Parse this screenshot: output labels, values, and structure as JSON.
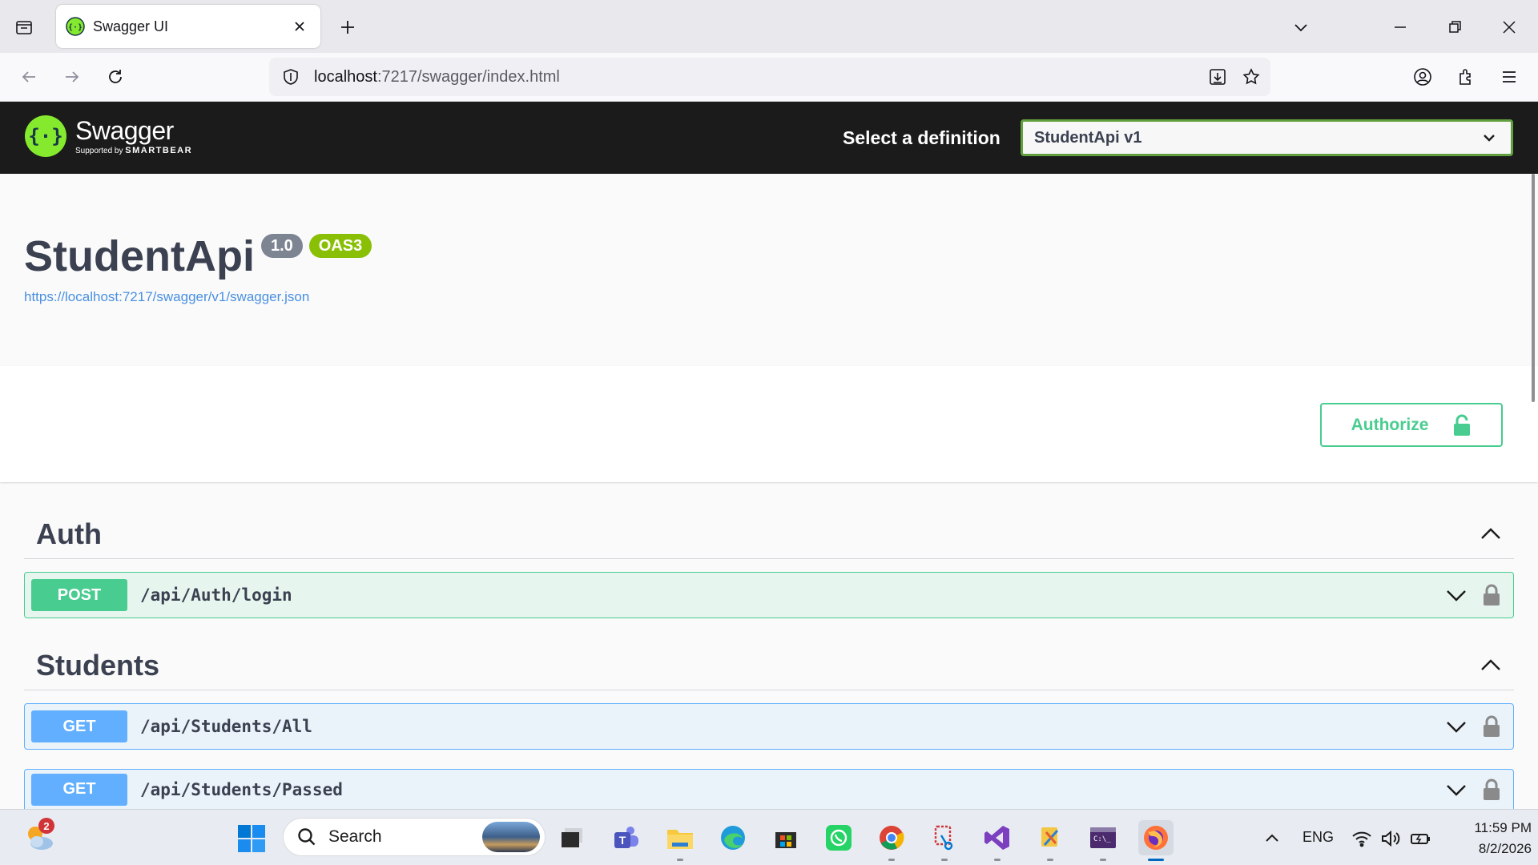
{
  "browser": {
    "tab_title": "Swagger UI",
    "url_host": "localhost",
    "url_rest": ":7217/swagger/index.html"
  },
  "swagger": {
    "logo_name": "Swagger",
    "logo_supported": "Supported by",
    "logo_brand": "SMARTBEAR",
    "definition_label": "Select a definition",
    "definition_selected": "StudentApi v1",
    "colors": {
      "topbar": "#1b1b1b",
      "accent_green": "#62a03f",
      "post": "#49cc90",
      "get": "#61affe",
      "oas_badge": "#89bf04"
    }
  },
  "info": {
    "title": "StudentApi",
    "version_badge": "1.0",
    "oas_badge": "OAS3",
    "spec_url": "https://localhost:7217/swagger/v1/swagger.json"
  },
  "scheme": {
    "authorize_label": "Authorize"
  },
  "tags": [
    {
      "name": "Auth",
      "operations": [
        {
          "method": "POST",
          "path": "/api/Auth/login"
        }
      ]
    },
    {
      "name": "Students",
      "operations": [
        {
          "method": "GET",
          "path": "/api/Students/All"
        },
        {
          "method": "GET",
          "path": "/api/Students/Passed"
        }
      ]
    }
  ],
  "taskbar": {
    "notification_count": "2",
    "search_label": "Search",
    "language": "ENG",
    "time": "11:59 PM",
    "date": "8/2/2026"
  }
}
